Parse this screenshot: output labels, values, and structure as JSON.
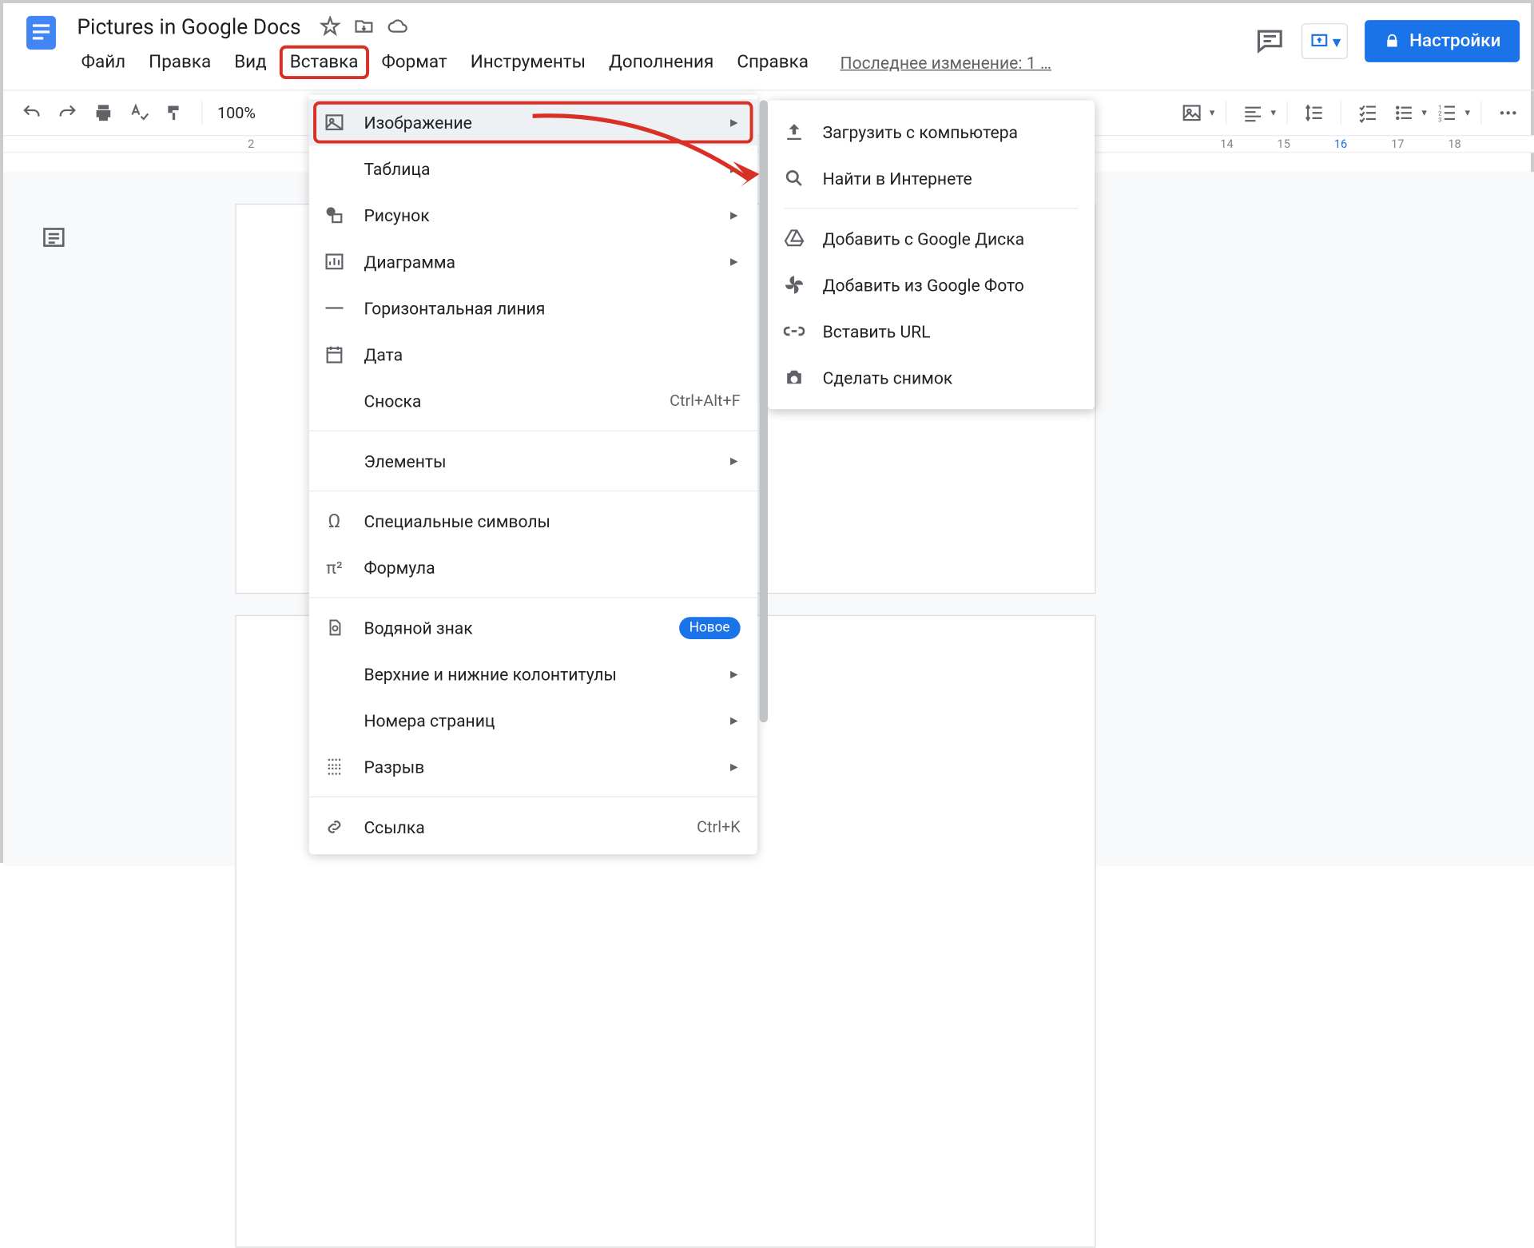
{
  "doc_title": "Pictures in Google Docs",
  "menubar": {
    "file": "Файл",
    "edit": "Правка",
    "view": "Вид",
    "insert": "Вставка",
    "format": "Формат",
    "tools": "Инструменты",
    "addons": "Дополнения",
    "help": "Справка"
  },
  "last_edit": "Последнее изменение: 1 …",
  "share_label": "Настройки",
  "zoom": "100%",
  "ruler_ticks": [
    "2",
    "14",
    "15",
    "16",
    "17",
    "18"
  ],
  "insert_menu": {
    "image": "Изображение",
    "table": "Таблица",
    "drawing": "Рисунок",
    "chart": "Диаграмма",
    "hr": "Горизонтальная линия",
    "date": "Дата",
    "footnote": "Сноска",
    "footnote_shortcut": "Ctrl+Alt+F",
    "elements": "Элементы",
    "special_chars": "Специальные символы",
    "equation": "Формула",
    "watermark": "Водяной знак",
    "watermark_badge": "Новое",
    "headers_footers": "Верхние и нижние колонтитулы",
    "page_numbers": "Номера страниц",
    "break": "Разрыв",
    "link": "Ссылка",
    "link_shortcut": "Ctrl+K"
  },
  "image_submenu": {
    "upload": "Загрузить с компьютера",
    "search_web": "Найти в Интернете",
    "drive": "Добавить с Google Диска",
    "photos": "Добавить из Google Фото",
    "url": "Вставить URL",
    "camera": "Сделать снимок"
  }
}
